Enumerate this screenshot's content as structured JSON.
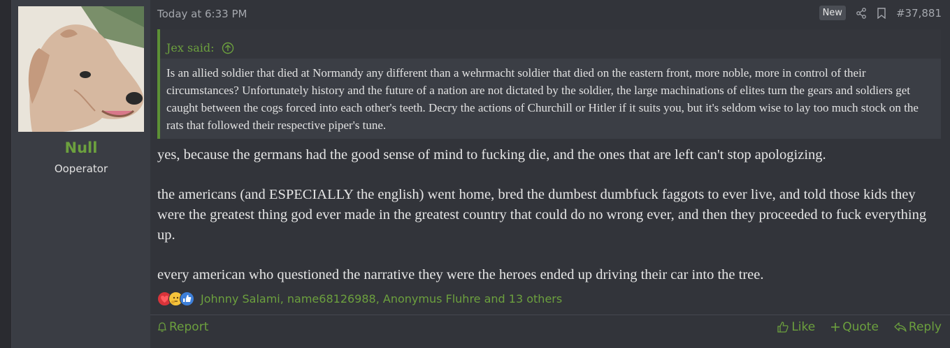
{
  "author": {
    "name": "Null",
    "title": "Ooperator"
  },
  "post": {
    "date": "Today at 6:33 PM",
    "badge": "New",
    "number": "#37,881",
    "quote": {
      "author": "Jex said:",
      "text": "Is an allied soldier that died at Normandy any different than a wehrmacht soldier that died on the eastern front, more noble, more in control of their circumstances? Unfortunately history and the future of a nation are not dictated by the soldier, the large machinations of elites turn the gears and soldiers get caught between the cogs forced into each other's teeth. Decry the actions of Churchill or Hitler if it suits you, but it's seldom wise to lay too much stock on the rats that followed their respective piper's tune."
    },
    "paragraphs": [
      "yes, because the germans had the good sense of mind to fucking die, and the ones that are left can't stop apologizing.",
      "the americans (and ESPECIALLY the english) went home, bred the dumbest dumbfuck faggots to ever live, and told those kids they were the greatest thing god ever made in the greatest country that could do no wrong ever, and then they proceeded to fuck everything up.",
      "every american who questioned the narrative they were the heroes ended up driving their car into the tree."
    ],
    "reactions_text": "Johnny Salami, name68126988, Anonymus Fluhre and 13 others",
    "reaction_icons": [
      "heart-icon",
      "thinking-face-icon",
      "thumbs-up-icon"
    ]
  },
  "footer": {
    "report": "Report",
    "like": "Like",
    "quote": "Quote",
    "reply": "Reply"
  },
  "colors": {
    "accent": "#6ca03e",
    "post_bg": "#32343a",
    "sidebar_bg": "#3a3d44",
    "quote_bg": "#3b3e45"
  }
}
